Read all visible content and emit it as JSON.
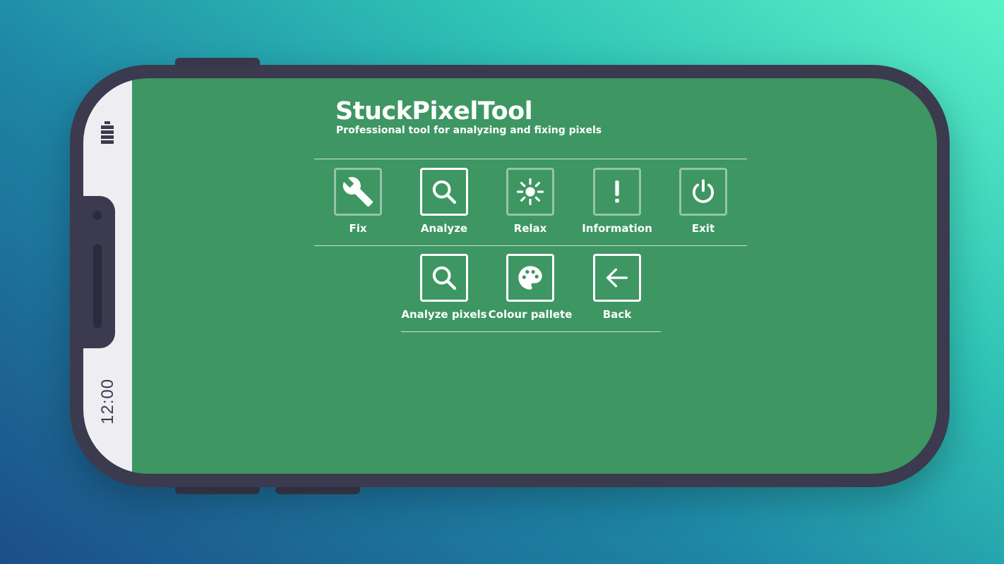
{
  "device": {
    "clock": "12:00"
  },
  "app": {
    "title": "StuckPixelTool",
    "subtitle": "Professional tool for analyzing and fixing pixels"
  },
  "menu_row1": [
    {
      "label": "Fix",
      "icon": "wrench-icon"
    },
    {
      "label": "Analyze",
      "icon": "magnifier-icon"
    },
    {
      "label": "Relax",
      "icon": "sun-icon"
    },
    {
      "label": "Information",
      "icon": "exclamation-icon"
    },
    {
      "label": "Exit",
      "icon": "power-icon"
    }
  ],
  "menu_row2": [
    {
      "label": "Analyze pixels",
      "icon": "magnifier-icon"
    },
    {
      "label": "Colour pallete",
      "icon": "palette-icon"
    },
    {
      "label": "Back",
      "icon": "arrow-left-icon"
    }
  ],
  "colors": {
    "screen_bg": "#3e9663",
    "phone_frame": "#3b3a4e",
    "status_strip": "#eeeef2",
    "icon_white": "#ffffff"
  }
}
